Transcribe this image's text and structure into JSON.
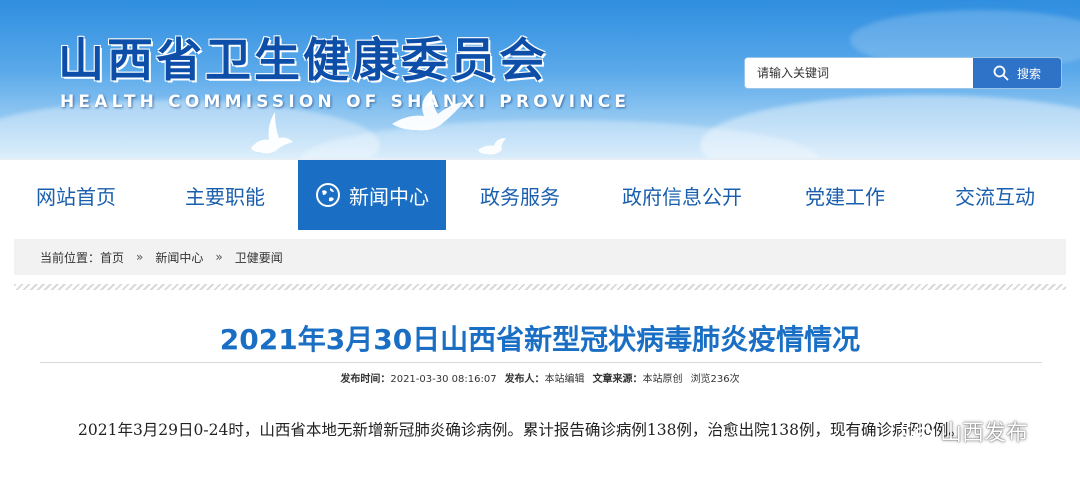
{
  "header": {
    "title": "山西省卫生健康委员会",
    "subtitle": "HEALTH COMMISSION OF SHANXI PROVINCE",
    "colors": {
      "brand_blue": "#0d4fa8",
      "sky_top": "#2f8ee0",
      "sky_bottom": "#c9e5f9"
    }
  },
  "search": {
    "placeholder": "请输入关键词",
    "button_label": "搜索",
    "icon": "search-icon"
  },
  "nav": {
    "items": [
      {
        "label": "网站首页",
        "active": false
      },
      {
        "label": "主要职能",
        "active": false
      },
      {
        "label": "新闻中心",
        "active": true,
        "icon": "globe-icon"
      },
      {
        "label": "政务服务",
        "active": false
      },
      {
        "label": "政府信息公开",
        "active": false
      },
      {
        "label": "党建工作",
        "active": false
      },
      {
        "label": "交流互动",
        "active": false
      }
    ],
    "active_color": "#1a6fc4"
  },
  "breadcrumb": {
    "prefix": "当前位置：",
    "items": [
      "首页",
      "新闻中心",
      "卫健要闻"
    ],
    "separator": "»"
  },
  "article": {
    "title": "2021年3月30日山西省新型冠状病毒肺炎疫情情况",
    "meta": {
      "publish_time_label": "发布时间：",
      "publish_time": "2021-03-30 08:16:07",
      "publisher_label": "发布人：",
      "publisher": "本站编辑",
      "source_label": "文章来源：",
      "source": "本站原创",
      "views": "浏览236次"
    },
    "body": "2021年3月29日0-24时，山西省本地无新增新冠肺炎确诊病例。累计报告确诊病例138例，治愈出院138例，现有确诊病例0例。"
  },
  "watermark": {
    "text": "山西发布",
    "icon": "wechat-icon"
  }
}
